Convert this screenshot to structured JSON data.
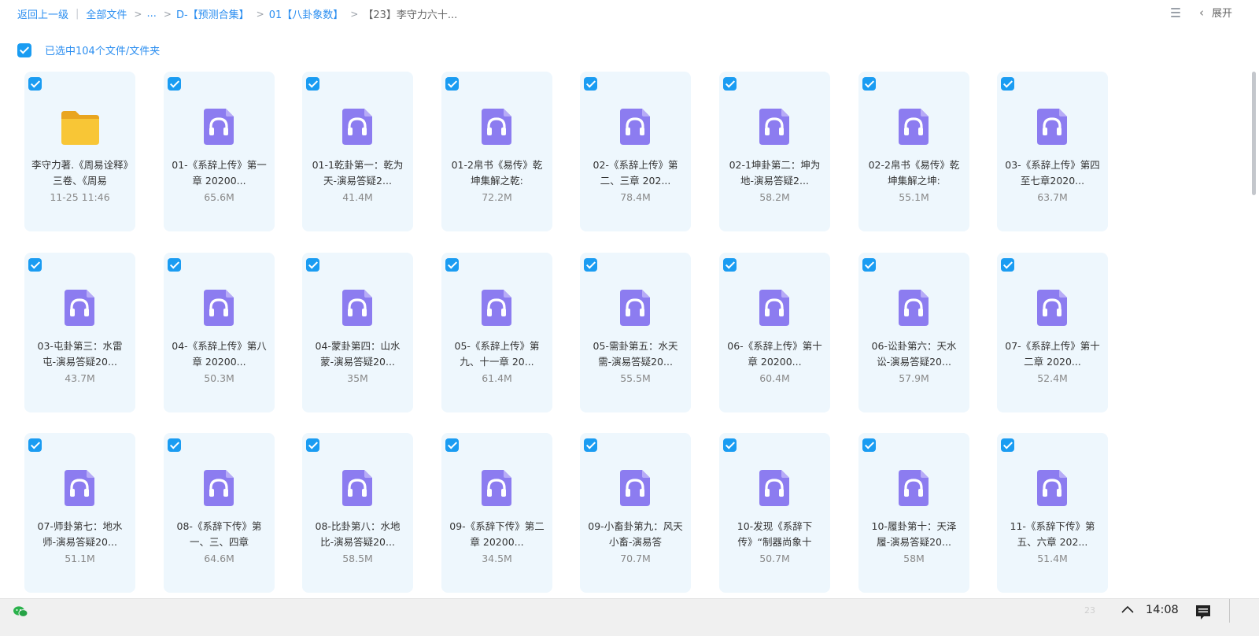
{
  "breadcrumb": {
    "back": "返回上一级",
    "all_files": "全部文件",
    "ellipsis": "...",
    "level1": "D-【预测合集】",
    "level2": "01【八卦象数】",
    "current": "【23】李守力六十..."
  },
  "toolbar": {
    "expand_label": "展开",
    "list_icon": "list-view-icon",
    "back_icon": "chevron-left-icon"
  },
  "selection": {
    "text": "已选中104个文件/文件夹",
    "checked": true
  },
  "colors": {
    "accent": "#1a9cf2",
    "card_bg": "#eef7fd",
    "audio_icon": "#8c7cf0",
    "folder": "#f8c636"
  },
  "files": [
    {
      "type": "folder",
      "name": "李守力著.《周易诠释》三卷、《周易",
      "meta": "11-25 11:46"
    },
    {
      "type": "audio",
      "name": "01-《系辞上传》第一章 20200...",
      "meta": "65.6M"
    },
    {
      "type": "audio",
      "name": "01-1乾卦第一：乾为天-演易答疑2...",
      "meta": "41.4M"
    },
    {
      "type": "audio",
      "name": "01-2帛书《易传》乾坤集解之乾:",
      "meta": "72.2M"
    },
    {
      "type": "audio",
      "name": "02-《系辞上传》第二、三章 202...",
      "meta": "78.4M"
    },
    {
      "type": "audio",
      "name": "02-1坤卦第二：坤为地-演易答疑2...",
      "meta": "58.2M"
    },
    {
      "type": "audio",
      "name": "02-2帛书《易传》乾坤集解之坤:",
      "meta": "55.1M"
    },
    {
      "type": "audio",
      "name": "03-《系辞上传》第四至七章2020...",
      "meta": "63.7M"
    },
    {
      "type": "audio",
      "name": "03-屯卦第三：水雷屯-演易答疑20...",
      "meta": "43.7M"
    },
    {
      "type": "audio",
      "name": "04-《系辞上传》第八章 20200...",
      "meta": "50.3M"
    },
    {
      "type": "audio",
      "name": "04-蒙卦第四：山水蒙-演易答疑20...",
      "meta": "35M"
    },
    {
      "type": "audio",
      "name": "05-《系辞上传》第九、十一章 20...",
      "meta": "61.4M"
    },
    {
      "type": "audio",
      "name": "05-需卦第五：水天需-演易答疑20...",
      "meta": "55.5M"
    },
    {
      "type": "audio",
      "name": "06-《系辞上传》第十章 20200...",
      "meta": "60.4M"
    },
    {
      "type": "audio",
      "name": "06-讼卦第六：天水讼-演易答疑20...",
      "meta": "57.9M"
    },
    {
      "type": "audio",
      "name": "07-《系辞上传》第十二章 2020...",
      "meta": "52.4M"
    },
    {
      "type": "audio",
      "name": "07-师卦第七：地水师-演易答疑20...",
      "meta": "51.1M"
    },
    {
      "type": "audio",
      "name": "08-《系辞下传》第一、三、四章",
      "meta": "64.6M"
    },
    {
      "type": "audio",
      "name": "08-比卦第八：水地比-演易答疑20...",
      "meta": "58.5M"
    },
    {
      "type": "audio",
      "name": "09-《系辞下传》第二章 20200...",
      "meta": "34.5M"
    },
    {
      "type": "audio",
      "name": "09-小畜卦第九：风天小畜-演易答",
      "meta": "70.7M"
    },
    {
      "type": "audio",
      "name": "10-发现《系辞下传》“制器尚象十",
      "meta": "50.7M"
    },
    {
      "type": "audio",
      "name": "10-履卦第十：天泽履-演易答疑20...",
      "meta": "58M"
    },
    {
      "type": "audio",
      "name": "11-《系辞下传》第五、六章 202...",
      "meta": "51.4M"
    }
  ],
  "taskbar": {
    "lang": "23",
    "clock": "14:08",
    "app_icon": "wechat-icon",
    "caret_icon": "chevron-up-icon",
    "notif_icon": "notification-icon"
  }
}
